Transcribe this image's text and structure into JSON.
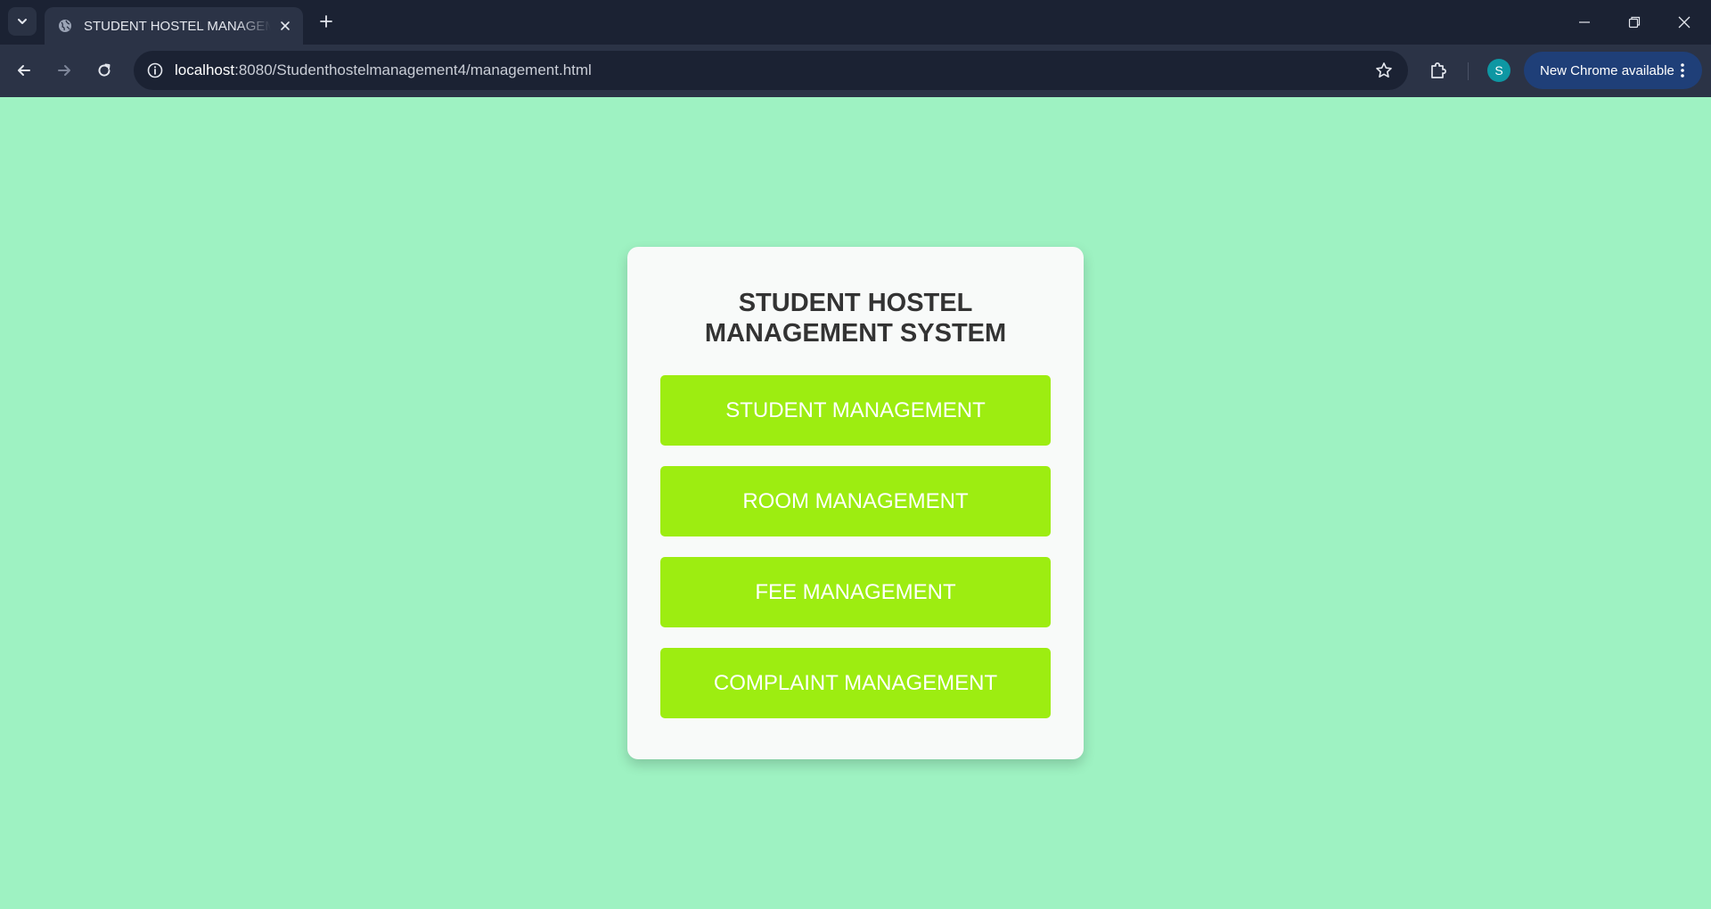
{
  "browser": {
    "tab": {
      "title": "STUDENT HOSTEL MANAGEMENT SYSTEM",
      "favicon": "globe-icon"
    },
    "address_bar": {
      "url_host": "localhost",
      "url_rest": ":8080/Studenthostelmanagement4/management.html"
    },
    "profile_initial": "S",
    "update_button_label": "New Chrome available",
    "icons": {
      "tab_search": "chevron-down-icon",
      "tab_close": "close-icon",
      "new_tab": "plus-icon",
      "back": "arrow-left-icon",
      "forward": "arrow-right-icon",
      "reload": "reload-icon",
      "site_info": "info-icon",
      "bookmark": "star-icon",
      "extensions": "puzzle-icon",
      "menu": "kebab-menu-icon",
      "minimize": "minimize-icon",
      "restore": "restore-icon",
      "close_window": "close-icon"
    }
  },
  "card": {
    "title_line1": "STUDENT HOSTEL",
    "title_line2": "MANAGEMENT SYSTEM",
    "buttons": [
      {
        "label": "STUDENT MANAGEMENT"
      },
      {
        "label": "ROOM MANAGEMENT"
      },
      {
        "label": "FEE MANAGEMENT"
      },
      {
        "label": "COMPLAINT MANAGEMENT"
      }
    ]
  },
  "colors": {
    "page_background": "#9ef2c2",
    "card_background": "#f8faf9",
    "button_background": "#9ded11",
    "button_text": "#ffffff",
    "title_text": "#333333",
    "browser_frame": "#1b2233",
    "browser_toolbar": "#2b3346",
    "update_pill": "#1f3f78",
    "avatar": "#0e97a3"
  }
}
